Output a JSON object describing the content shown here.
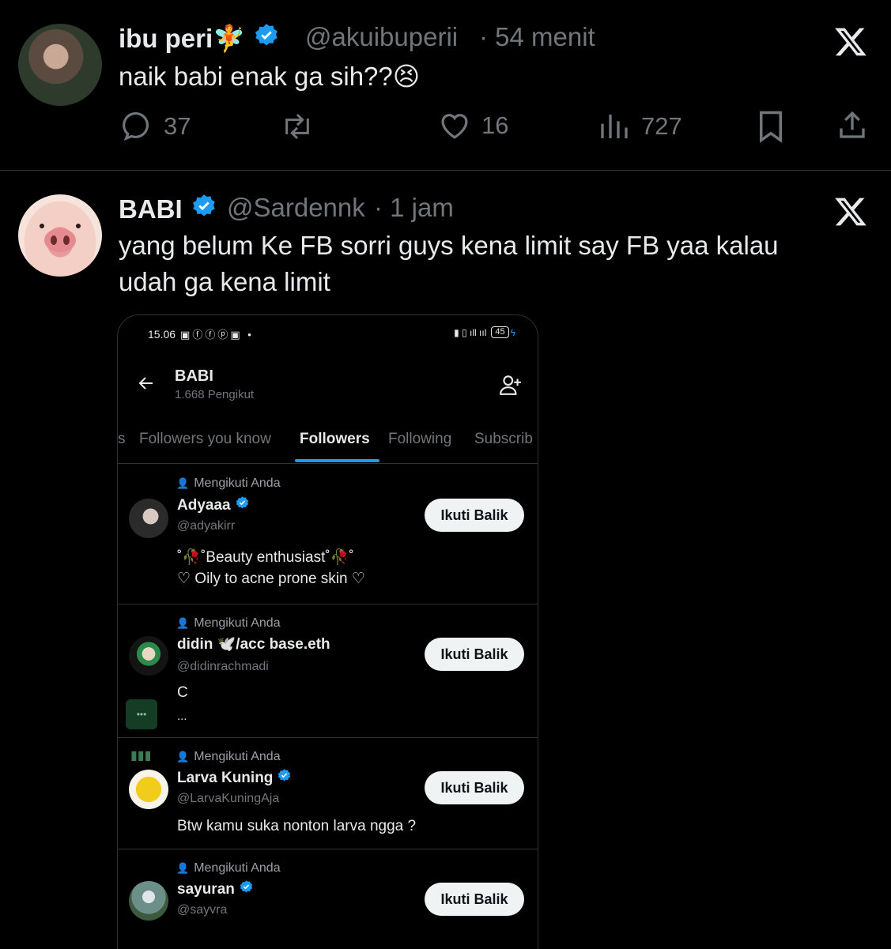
{
  "tweet1": {
    "name": "ibu peri🧚",
    "handle": "@akuibuperii",
    "time": "· 54 menit",
    "text": "naik babi enak ga sih??😣",
    "replies": "37",
    "likes": "16",
    "views": "727"
  },
  "tweet2": {
    "name": "BABI",
    "handle": "@Sardennk",
    "time": "· 1 jam",
    "text": "yang belum Ke FB sorri guys kena limit say FB yaa kalau udah ga kena limit"
  },
  "screenshot": {
    "status_time": "15.06",
    "battery": "45",
    "title": "BABI",
    "subtitle": "1.668 Pengikut",
    "tabs": [
      "s",
      "Followers you know",
      "Followers",
      "Following",
      "Subscrib"
    ],
    "followers": [
      {
        "follows_you": "Mengikuti Anda",
        "name": "Adyaaa",
        "handle": "@adyakirr",
        "bio_line1": "˚🥀˚Beauty enthusiast˚🥀˚",
        "bio_line2": "♡ Oily to acne prone skin ♡",
        "button": "Ikuti Balik"
      },
      {
        "follows_you": "Mengikuti Anda",
        "name": "didin 🕊️/acc base.eth",
        "handle": "@didinrachmadi",
        "bio_line1": "C",
        "bio_line2": "...",
        "button": "Ikuti Balik"
      },
      {
        "follows_you": "Mengikuti Anda",
        "name": "Larva Kuning",
        "handle": "@LarvaKuningAja",
        "bio_line1": "Btw kamu suka nonton larva ngga ?",
        "button": "Ikuti Balik"
      },
      {
        "follows_you": "Mengikuti Anda",
        "name": "sayuran",
        "handle": "@sayvra",
        "button": "Ikuti Balik"
      }
    ]
  },
  "colors": {
    "background": "#000000",
    "text": "#e7e9ea",
    "secondary": "#71767b",
    "accent": "#1d9bf0",
    "divider": "#2f3336"
  }
}
